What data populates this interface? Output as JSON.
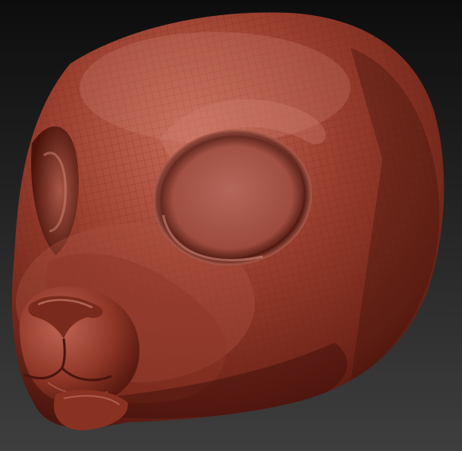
{
  "scene": {
    "subject": "sculpted-creature-head",
    "colors": {
      "background_top": "#0d0d0d",
      "background_bottom": "#3e3e3e",
      "clay_base": "#9a3e2e",
      "clay_highlight": "#c66a58",
      "clay_shadow": "#4a150e",
      "wireframe": "#5e1d13"
    }
  }
}
